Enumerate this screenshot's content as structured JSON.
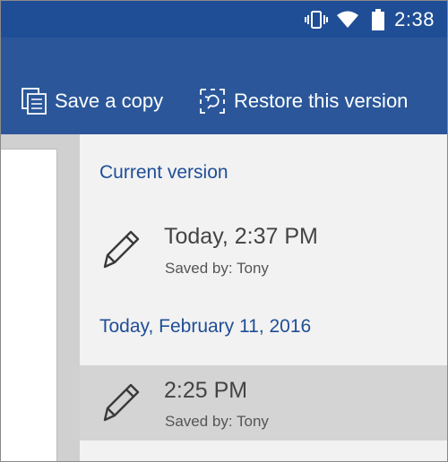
{
  "status_bar": {
    "time": "2:38",
    "icons": [
      "vibrate-icon",
      "wifi-icon",
      "battery-icon"
    ]
  },
  "toolbar": {
    "save_copy_label": "Save a copy",
    "save_copy_icon": "copy-document-icon",
    "restore_label": "Restore this version",
    "restore_icon": "restore-icon"
  },
  "versions": {
    "current_heading": "Current version",
    "current": {
      "time": "Today, 2:37 PM",
      "saved_by": "Saved by: Tony",
      "icon": "pencil-icon"
    },
    "group_heading": "Today, February 11, 2016",
    "items": [
      {
        "time": "2:25 PM",
        "saved_by": "Saved by: Tony",
        "icon": "pencil-icon",
        "selected": true
      }
    ]
  },
  "colors": {
    "status_bar": "#1f4e96",
    "toolbar": "#2b579a",
    "heading_text": "#1f4e96",
    "panel_bg": "#f2f2f2",
    "selected_bg": "#d4d4d4"
  }
}
